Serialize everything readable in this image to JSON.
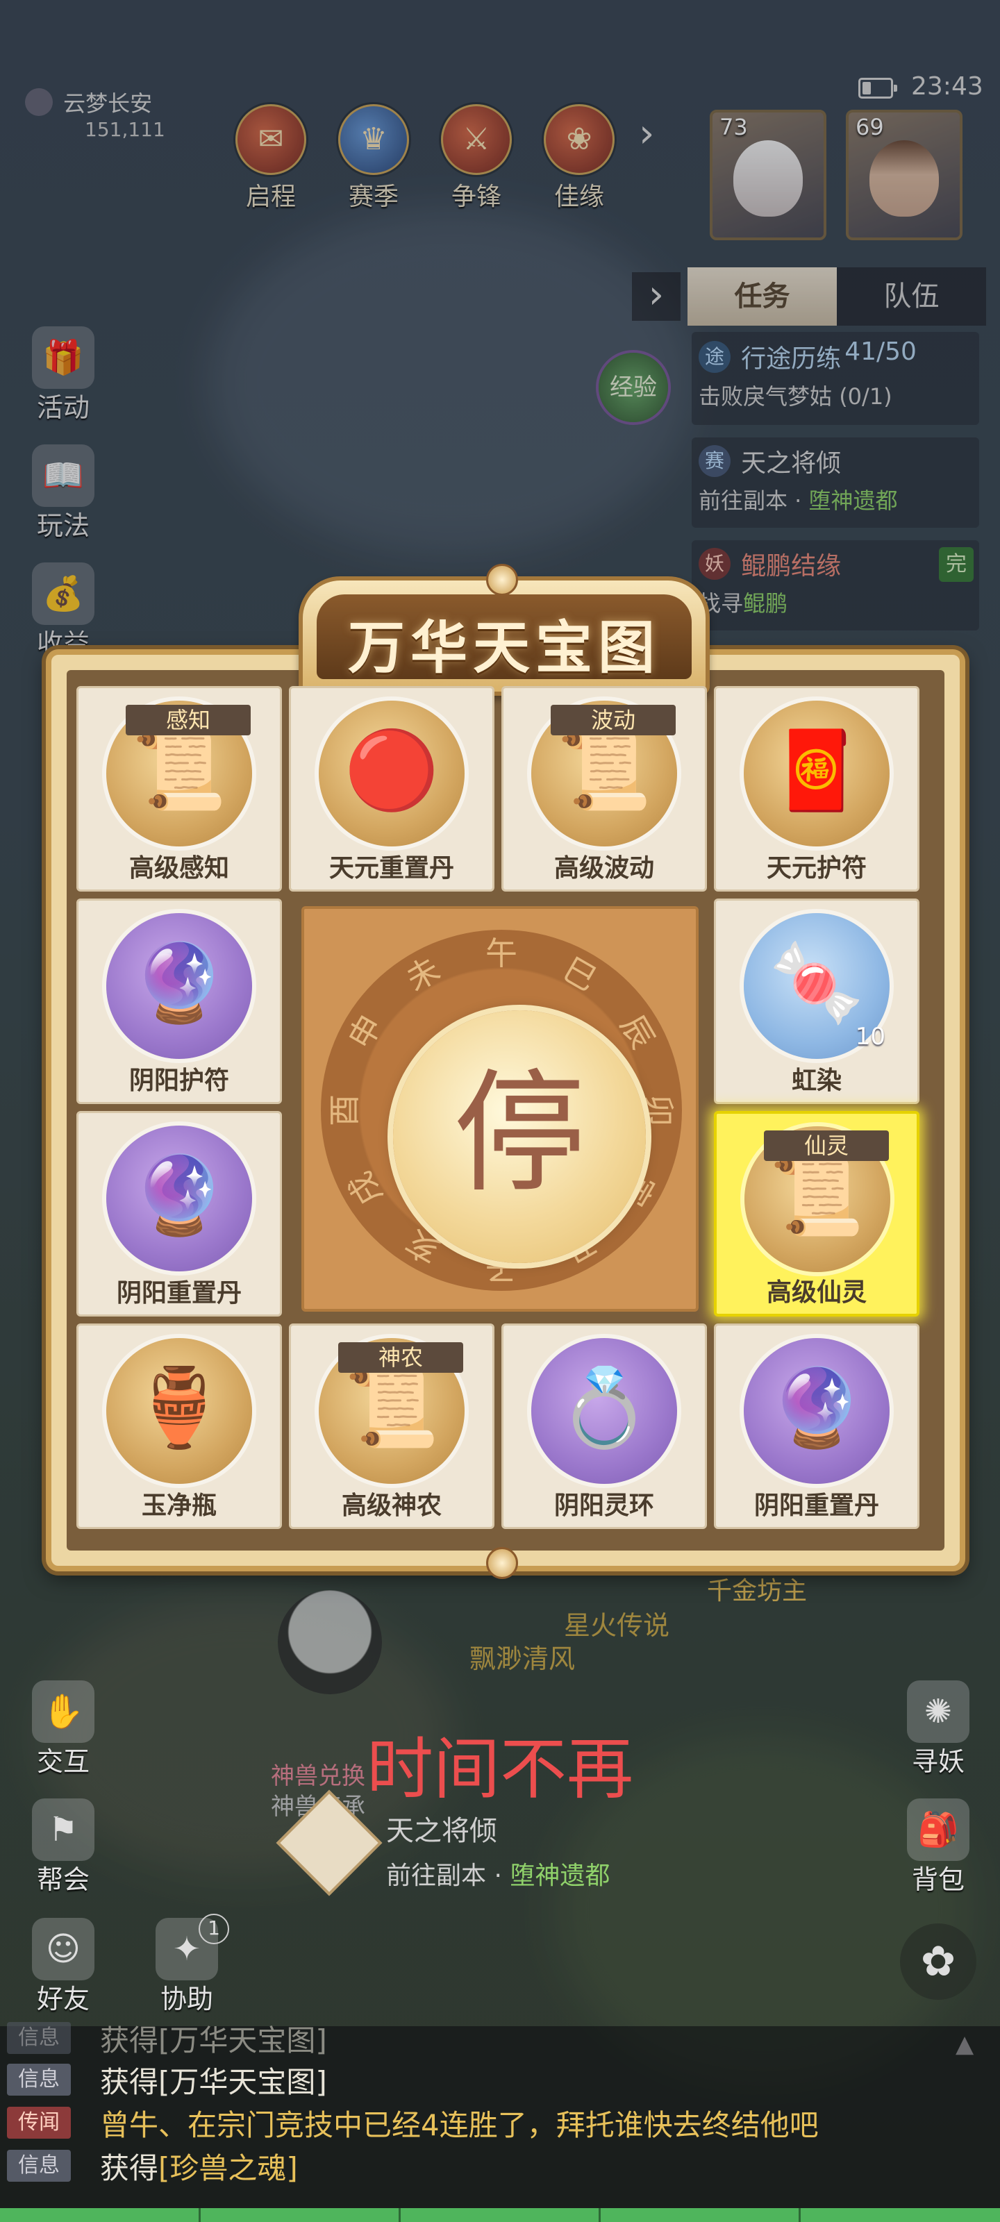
{
  "status": {
    "time": "23:43"
  },
  "server": {
    "name": "云梦长安",
    "id": "151,111"
  },
  "top_menu": [
    {
      "label": "启程",
      "icon": "scroll-icon"
    },
    {
      "label": "赛季",
      "icon": "trophy-icon"
    },
    {
      "label": "争锋",
      "icon": "battle-icon"
    },
    {
      "label": "佳缘",
      "icon": "gift-icon"
    }
  ],
  "party": [
    {
      "level": "73"
    },
    {
      "level": "69"
    }
  ],
  "task_panel": {
    "tabs": [
      "任务",
      "队伍"
    ],
    "items": [
      {
        "badge": "途",
        "title": "行途历练",
        "progress": "41/50",
        "sub": "击败戾气梦姑",
        "sub_count": "(0/1)"
      },
      {
        "badge": "赛",
        "title": "天之将倾",
        "sub_prefix": "前往副本 · ",
        "sub_hl": "堕神遗都"
      },
      {
        "badge": "妖",
        "title": "鲲鹏结缘",
        "done": "完",
        "sub_prefix": "找寻",
        "sub_hl": "鲲鹏"
      }
    ],
    "exp_label": "经验"
  },
  "left_menu": [
    "活动",
    "玩法",
    "收益"
  ],
  "modal": {
    "title": "万华天宝图",
    "center_button": "停",
    "dial_chars": [
      "子",
      "丑",
      "寅",
      "卯",
      "辰",
      "巳",
      "午",
      "未",
      "申",
      "酉",
      "戌",
      "亥"
    ],
    "cells": [
      {
        "name": "高级感知",
        "tag": "感知",
        "icon": "scroll-icon",
        "disc": "gold"
      },
      {
        "name": "天元重置丹",
        "icon": "red-orb-icon",
        "disc": "gold"
      },
      {
        "name": "高级波动",
        "tag": "波动",
        "icon": "scroll-icon",
        "disc": "gold"
      },
      {
        "name": "天元护符",
        "icon": "red-amulet-icon",
        "disc": "gold"
      },
      {
        "name": "阴阳护符",
        "icon": "purple-amulet-icon",
        "disc": "purple"
      },
      {
        "name": "虹染",
        "count": "10",
        "icon": "dye-icon",
        "disc": "blue"
      },
      {
        "name": "阴阳重置丹",
        "icon": "purple-orb-icon",
        "disc": "purple"
      },
      {
        "name": "高级仙灵",
        "tag": "仙灵",
        "icon": "scroll-icon",
        "disc": "gold",
        "highlight": true
      },
      {
        "name": "玉净瓶",
        "icon": "vase-icon",
        "disc": "gold"
      },
      {
        "name": "高级神农",
        "tag": "神农",
        "icon": "scroll-icon",
        "disc": "gold"
      },
      {
        "name": "阴阳灵环",
        "icon": "ring-icon",
        "disc": "purple"
      },
      {
        "name": "阴阳重置丹",
        "icon": "purple-orb-icon",
        "disc": "purple"
      }
    ]
  },
  "world_labels": {
    "a": "千金坊主",
    "b": "星火传说",
    "c": "飘渺清风",
    "d": "神兽兑换",
    "e": "神兽传承"
  },
  "caption": "时间不再",
  "bottom_quest": {
    "title": "天之将倾",
    "sub_prefix": "前往副本 · ",
    "sub_hl": "堕神遗都"
  },
  "bottom_left": [
    "交互",
    "帮会",
    "好友",
    "协助"
  ],
  "bottom_right": [
    "寻妖",
    "背包"
  ],
  "assist_badge": "1",
  "chat": [
    {
      "tag": "信息",
      "text_prefix": "获得",
      "text_item": "[万华天宝图]"
    },
    {
      "tag": "信息",
      "text_prefix": "获得",
      "text_item": "[万华天宝图]"
    },
    {
      "tag": "传闻",
      "text": "曾牛、在宗门竞技中已经4连胜了，拜托谁快去终结他吧"
    },
    {
      "tag": "信息",
      "text_prefix": "获得",
      "text_item": "[珍兽之魂]"
    }
  ],
  "colors": {
    "highlight": "#fff25c",
    "caption": "#ec4e4e",
    "quest_green": "#8fd16a"
  }
}
